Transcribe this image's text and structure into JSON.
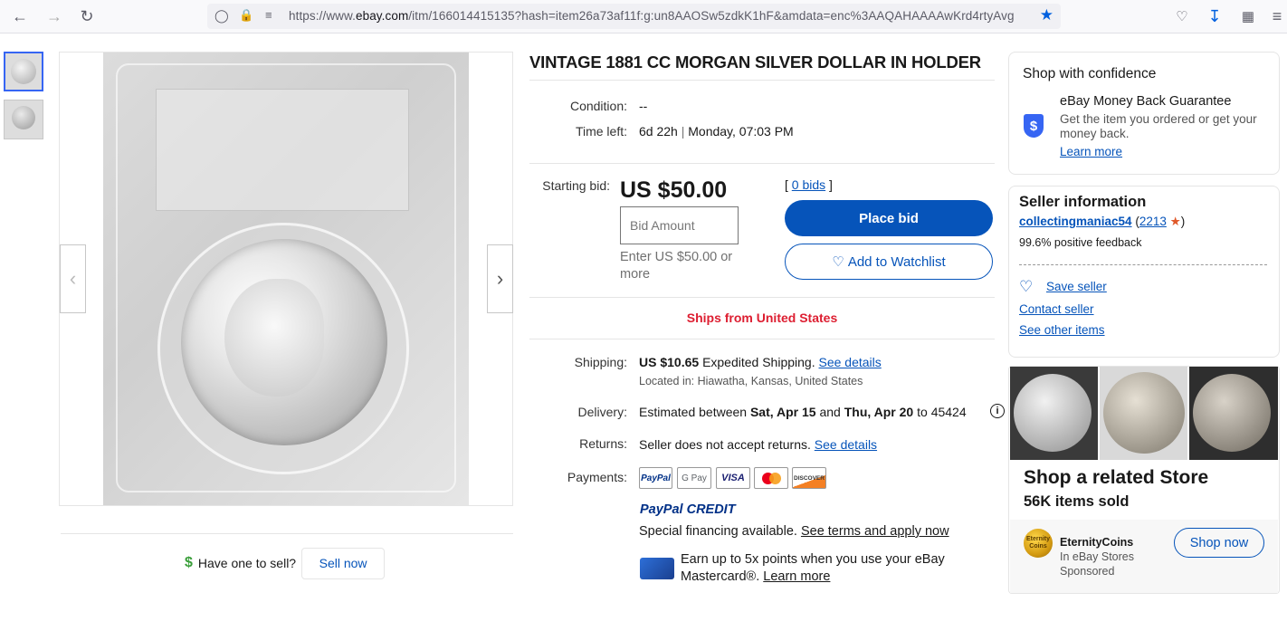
{
  "browser": {
    "url_prefix": "https://www.",
    "url_domain": "ebay.com",
    "url_rest": "/itm/166014415135?hash=item26a73af11f:g:un8AAOSw5zdkK1hF&amdata=enc%3AAQAHAAAAwKrd4rtyAvg"
  },
  "listing": {
    "title": "VINTAGE 1881 CC MORGAN SILVER DOLLAR IN HOLDER",
    "condition_label": "Condition:",
    "condition_value": "--",
    "time_left_label": "Time left:",
    "time_left_value": "6d 22h",
    "time_left_end": "Monday, 07:03 PM",
    "starting_bid_label": "Starting bid:",
    "starting_bid_value": "US $50.00",
    "bid_placeholder": "Bid Amount",
    "bid_hint": "Enter US $50.00 or more",
    "bids_count": "0 bids",
    "place_bid_label": "Place bid",
    "watchlist_label": "Add to Watchlist",
    "ships_from": "Ships from United States"
  },
  "shipping": {
    "label": "Shipping:",
    "price": "US $10.65",
    "method": "Expedited Shipping.",
    "details_link": "See details",
    "located": "Located in: Hiawatha, Kansas, United States"
  },
  "delivery": {
    "label": "Delivery:",
    "prefix": "Estimated between",
    "date_from": "Sat, Apr 15",
    "and": "and",
    "date_to": "Thu, Apr 20",
    "to_zip": "to 45424"
  },
  "returns": {
    "label": "Returns:",
    "text": "Seller does not accept returns.",
    "details_link": "See details"
  },
  "payments": {
    "label": "Payments:",
    "methods": [
      "PayPal",
      "G Pay",
      "VISA",
      "Mastercard",
      "DISCOVER"
    ],
    "paypal_credit": "PayPal CREDIT",
    "financing_text": "Special financing available.",
    "financing_link": "See terms and apply now",
    "card_offer": "Earn up to 5x points when you use your eBay Mastercard®.",
    "card_offer_link": "Learn more"
  },
  "sell": {
    "prompt": "Have one to sell?",
    "button": "Sell now"
  },
  "confidence": {
    "title": "Shop with confidence",
    "guarantee_title": "eBay Money Back Guarantee",
    "guarantee_text": "Get the item you ordered or get your money back.",
    "learn_more": "Learn more"
  },
  "seller": {
    "title": "Seller information",
    "name": "collectingmaniac54",
    "feedback_count": "2213",
    "positive": "99.6% positive feedback",
    "save": "Save seller",
    "contact": "Contact seller",
    "other_items": "See other items"
  },
  "store": {
    "title": "Shop a related Store",
    "sold": "56K items sold",
    "name": "EternityCoins",
    "sub": "In eBay Stores",
    "sponsored": "Sponsored",
    "shop_now": "Shop now",
    "logo_text": "Eternity Coins"
  },
  "colors": {
    "brand_blue": "#0654ba",
    "alert_red": "#dd1e31",
    "shield_blue": "#3665f3"
  }
}
